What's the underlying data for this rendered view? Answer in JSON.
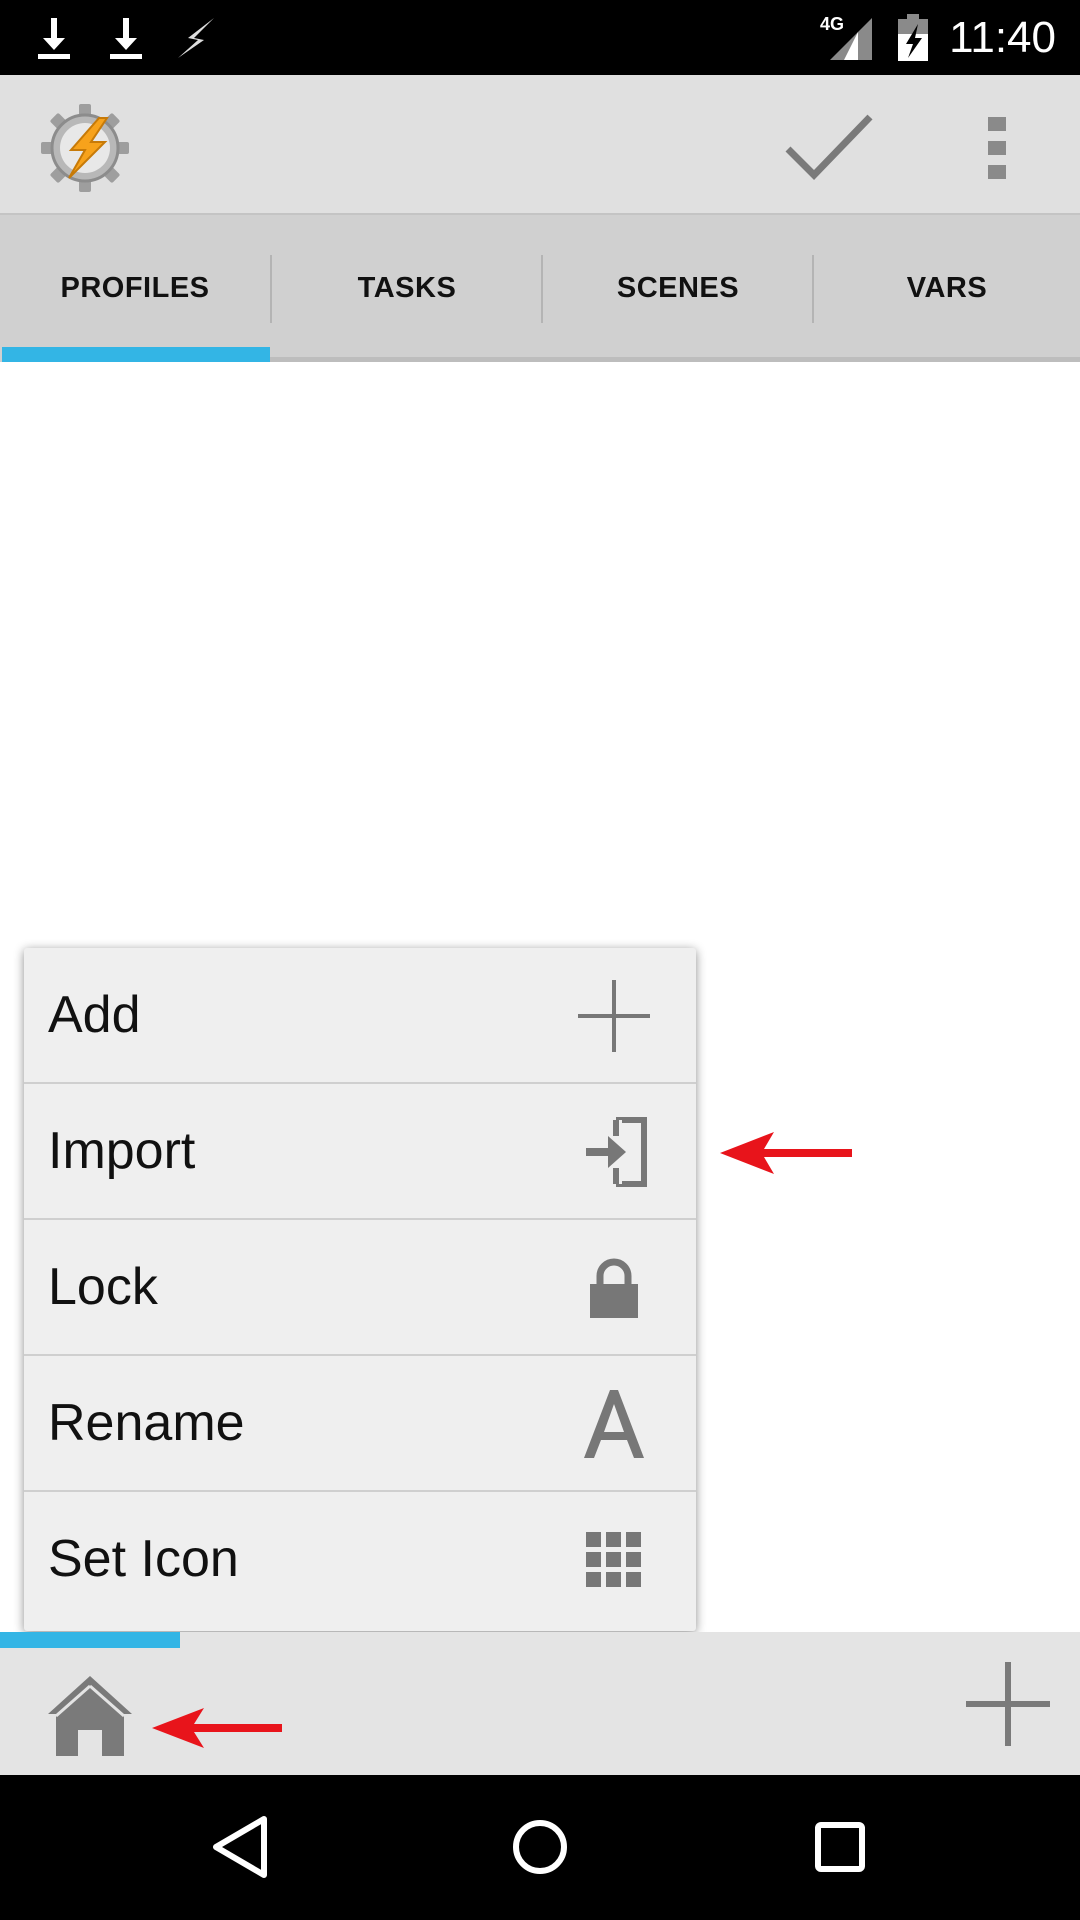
{
  "status_bar": {
    "time": "11:40",
    "network_label": "4G",
    "icons": [
      "download-icon",
      "download-icon",
      "flash-icon",
      "signal-icon",
      "battery-icon"
    ]
  },
  "action_bar": {
    "app_icon": "tasker-gear-bolt-icon",
    "confirm_icon": "check-icon",
    "overflow_icon": "more-vert-icon"
  },
  "tabs": [
    {
      "label": "PROFILES",
      "selected": true
    },
    {
      "label": "TASKS",
      "selected": false
    },
    {
      "label": "SCENES",
      "selected": false
    },
    {
      "label": "VARS",
      "selected": false
    }
  ],
  "popup_menu": {
    "items": [
      {
        "label": "Add",
        "icon": "plus-icon"
      },
      {
        "label": "Import",
        "icon": "import-icon"
      },
      {
        "label": "Lock",
        "icon": "lock-icon"
      },
      {
        "label": "Rename",
        "icon": "letter-a-icon"
      },
      {
        "label": "Set Icon",
        "icon": "grid-icon"
      }
    ]
  },
  "bottom_bar": {
    "home_icon": "home-icon",
    "add_icon": "plus-icon"
  },
  "nav_bar": {
    "icons": [
      "back-icon",
      "home-circle-icon",
      "recents-icon"
    ]
  },
  "colors": {
    "accent": "#33b5e5",
    "annotation_arrow": "#e8141b",
    "icon_gray": "#777777"
  }
}
